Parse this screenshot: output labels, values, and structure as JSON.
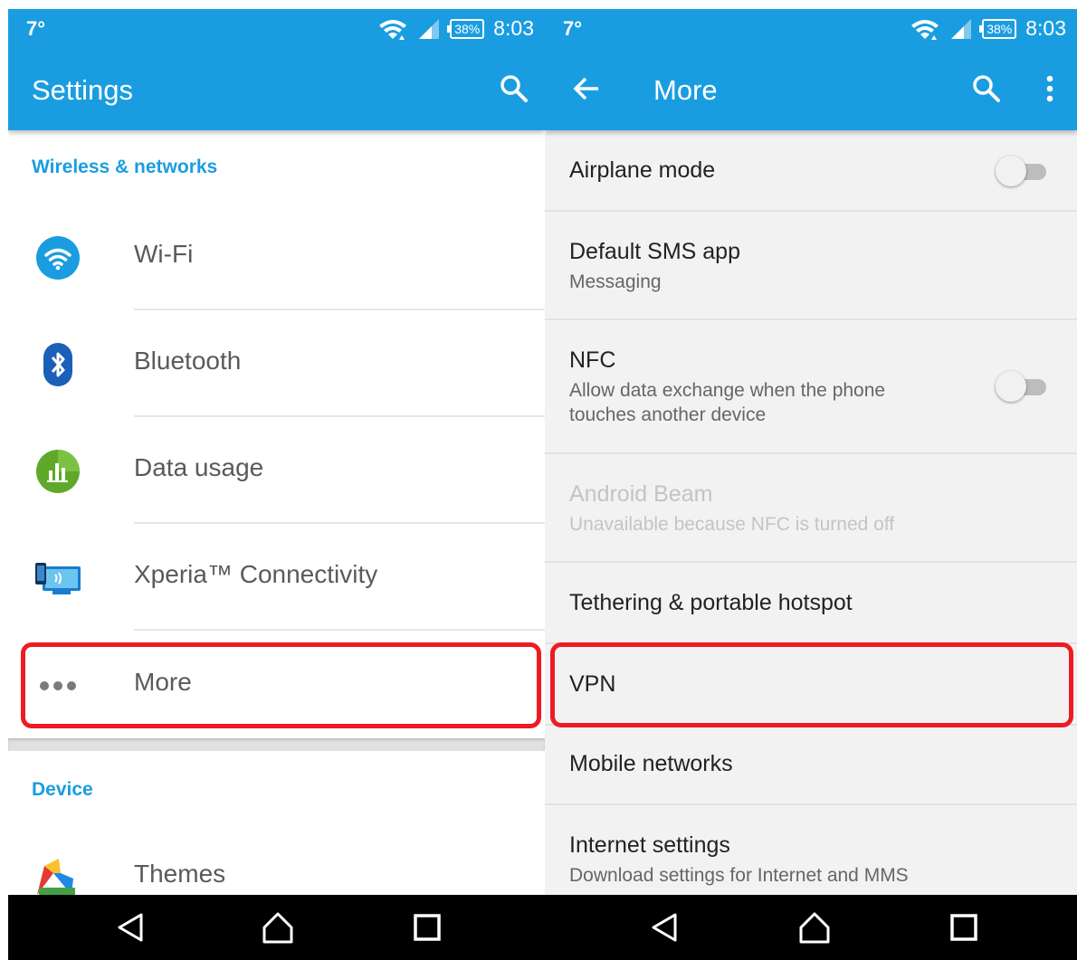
{
  "status": {
    "left_text": "7°",
    "battery": "38%",
    "time": "8:03"
  },
  "settings": {
    "title": "Settings",
    "sections": [
      {
        "header": "Wireless & networks"
      },
      {
        "header": "Device"
      }
    ],
    "items": [
      {
        "label": "Wi-Fi",
        "icon": "wifi-icon"
      },
      {
        "label": "Bluetooth",
        "icon": "bluetooth-icon"
      },
      {
        "label": "Data usage",
        "icon": "data-usage-icon"
      },
      {
        "label": "Xperia™ Connectivity",
        "icon": "xperia-connectivity-icon"
      },
      {
        "label": "More",
        "icon": "more-dots-icon"
      },
      {
        "label": "Themes",
        "icon": "themes-icon"
      }
    ]
  },
  "more": {
    "title": "More",
    "items": [
      {
        "title": "Airplane mode",
        "subtitle": "",
        "toggle": false
      },
      {
        "title": "Default SMS app",
        "subtitle": "Messaging"
      },
      {
        "title": "NFC",
        "subtitle": "Allow data exchange when the phone touches another device",
        "toggle": false
      },
      {
        "title": "Android Beam",
        "subtitle": "Unavailable because NFC is turned off",
        "disabled": true
      },
      {
        "title": "Tethering & portable hotspot",
        "subtitle": ""
      },
      {
        "title": "VPN",
        "subtitle": ""
      },
      {
        "title": "Mobile networks",
        "subtitle": ""
      },
      {
        "title": "Internet settings",
        "subtitle": "Download settings for Internet and MMS"
      }
    ]
  },
  "colors": {
    "accent": "#1a9de0",
    "highlight": "#ec1c24"
  }
}
